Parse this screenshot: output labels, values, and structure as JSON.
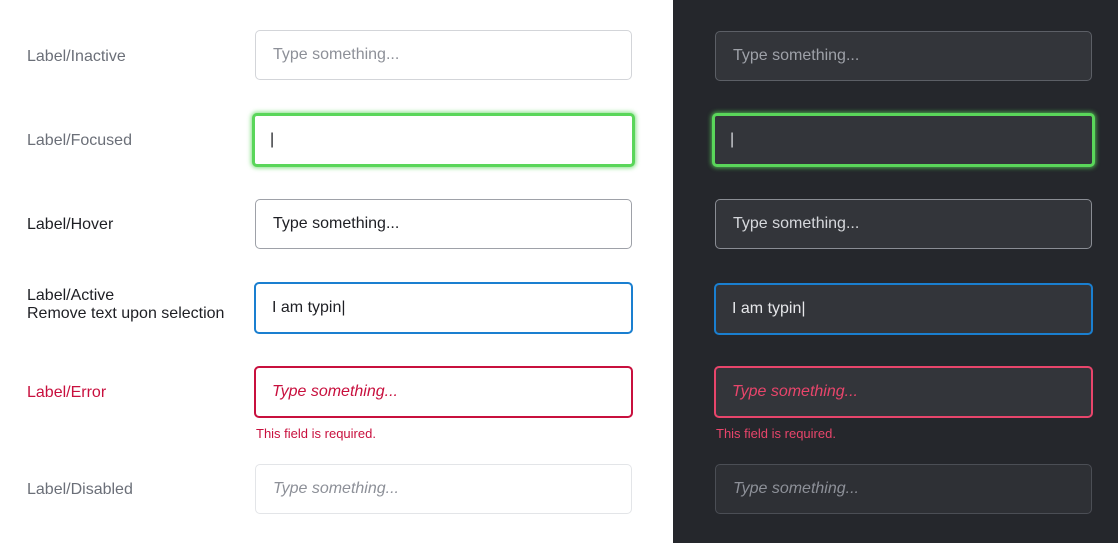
{
  "labels": {
    "inactive": "Label/Inactive",
    "focused": "Label/Focused",
    "hover": "Label/Hover",
    "active_line1": "Label/Active",
    "active_line2": "Remove text upon selection",
    "error": "Label/Error",
    "disabled": "Label/Disabled"
  },
  "light": {
    "inactive_placeholder": "Type something...",
    "focused_value": "|",
    "hover_placeholder": "Type something...",
    "active_value": "I am typin|",
    "error_placeholder": "Type something...",
    "error_helper": "This field is required.",
    "disabled_placeholder": "Type something..."
  },
  "dark": {
    "inactive_placeholder": "Type something...",
    "focused_value": "|",
    "hover_placeholder": "Type something...",
    "active_value": "I am typin|",
    "error_placeholder": "Type something...",
    "error_helper": "This field is required.",
    "disabled_placeholder": "Type something..."
  },
  "colors": {
    "focus": "#5ad65a",
    "active": "#1a7fd0",
    "error_light": "#c8103e",
    "error_dark": "#e8456b",
    "dark_background": "#25272c"
  }
}
